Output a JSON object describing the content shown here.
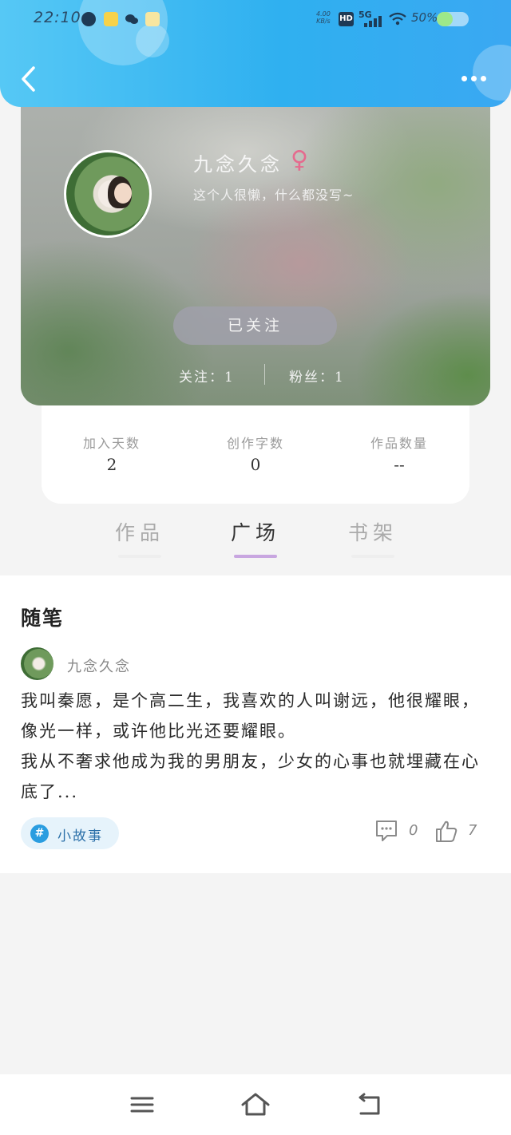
{
  "status_bar": {
    "time": "22:10",
    "speed": "4.00",
    "speed_unit": "KB/s",
    "hd": "HD",
    "network": "5G",
    "battery": "50%",
    "battery_level": 0.5
  },
  "profile": {
    "name": "九念久念",
    "gender_symbol": "♀",
    "bio": "这个人很懒，什么都没写~",
    "follow_button": "已关注",
    "following": "关注：1",
    "fans": "粉丝：1"
  },
  "stats": [
    {
      "label": "加入天数",
      "value": "2"
    },
    {
      "label": "创作字数",
      "value": "0"
    },
    {
      "label": "作品数量",
      "value": "--"
    }
  ],
  "tabs": [
    {
      "label": "作品"
    },
    {
      "label": "广场"
    },
    {
      "label": "书架"
    }
  ],
  "active_tab": "广场",
  "feed": {
    "section_title": "随笔",
    "post": {
      "author": "九念久念",
      "content_line1": "我叫秦愿，是个高二生，我喜欢的人叫谢远，他很耀眼，像光一样，或许他比光还要耀眼。",
      "content_line2": "我从不奢求他成为我的男朋友，少女的心事也就埋藏在心底了...",
      "tag": "小故事",
      "comments": "0",
      "likes": "7"
    }
  },
  "colors": {
    "header": "#2fb0f0",
    "tab_indicator": "#c8a6e0",
    "gender": "#e56b8e",
    "tag": "#2a9de0"
  }
}
